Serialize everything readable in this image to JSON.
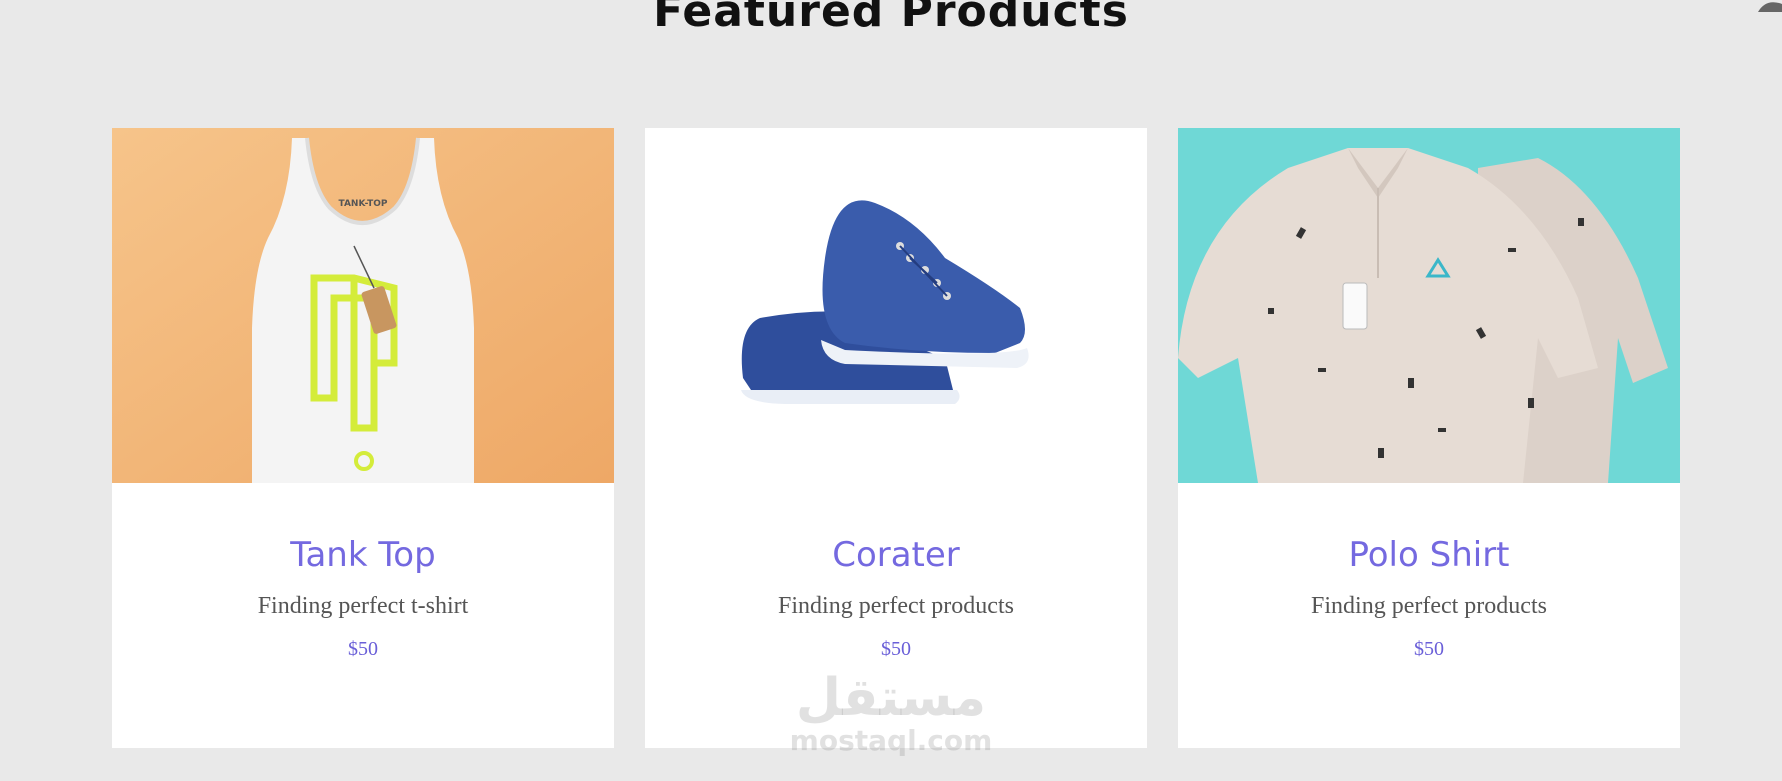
{
  "page": {
    "title": "Featured Products"
  },
  "products": [
    {
      "name": "Tank Top",
      "description": "Finding perfect t-shirt",
      "price": "$50",
      "image": "tank-top-image",
      "bg": "#f2b36f"
    },
    {
      "name": "Corater",
      "description": "Finding perfect products",
      "price": "$50",
      "image": "blue-sneaker-image",
      "bg": "#ffffff"
    },
    {
      "name": "Polo Shirt",
      "description": "Finding perfect products",
      "price": "$50",
      "image": "polo-shirt-image",
      "bg": "#6fd8d6"
    }
  ],
  "watermark": {
    "arabic": "مستقل",
    "domain": "mostaql.com"
  },
  "colors": {
    "accent": "#7469e0",
    "background": "#e9e9e9",
    "card": "#ffffff"
  }
}
